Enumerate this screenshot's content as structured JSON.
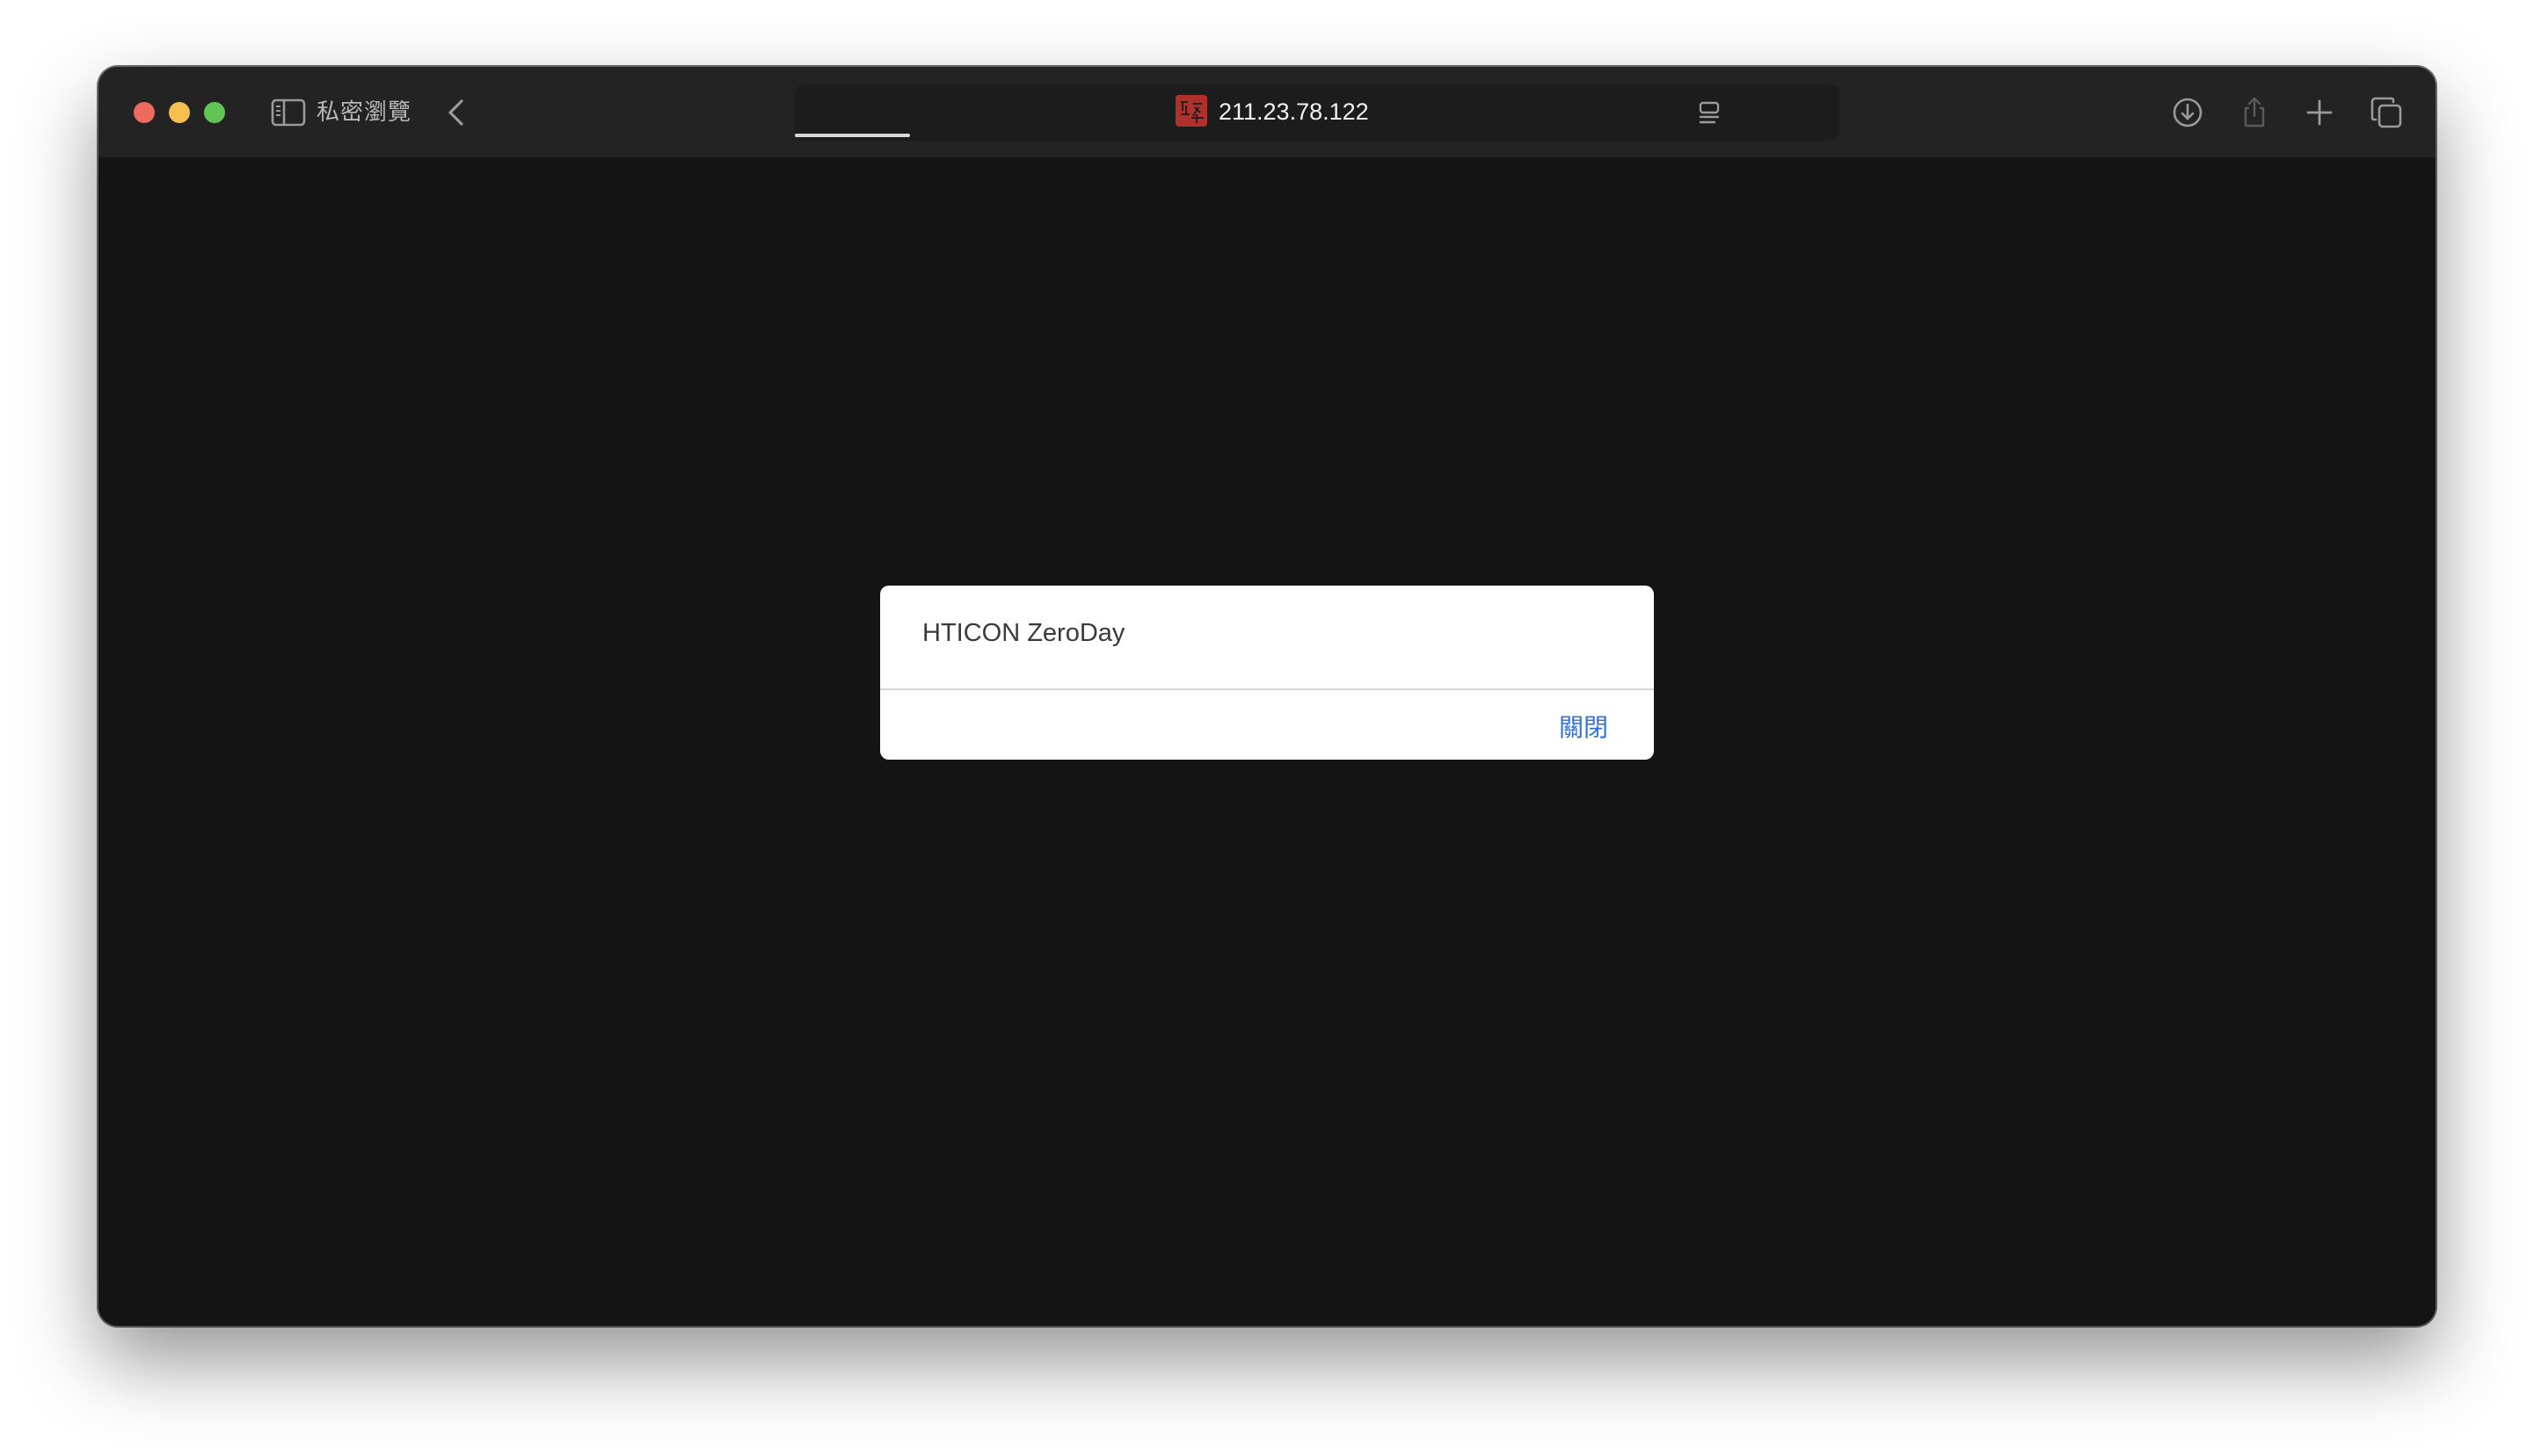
{
  "browser": {
    "private_label": "私密瀏覽",
    "address": "211.23.78.122",
    "load_progress": 0.11,
    "icons": {
      "sidebar": "sidebar-icon",
      "back": "chevron-left-icon",
      "favicon": "site-favicon",
      "reader": "reader-icon",
      "download": "download-icon",
      "share": "share-icon",
      "new_tab": "plus-icon",
      "tab_overview": "tab-overview-icon"
    }
  },
  "dialog": {
    "message": "HTICON ZeroDay",
    "close_label": "關閉",
    "close_color": "#2f6fd8"
  },
  "colors": {
    "page_background": "#141414",
    "toolbar_background": "#232323",
    "close_light": "#ed6a5e",
    "minimize_light": "#f5bf4f",
    "maximize_light": "#61c554"
  }
}
